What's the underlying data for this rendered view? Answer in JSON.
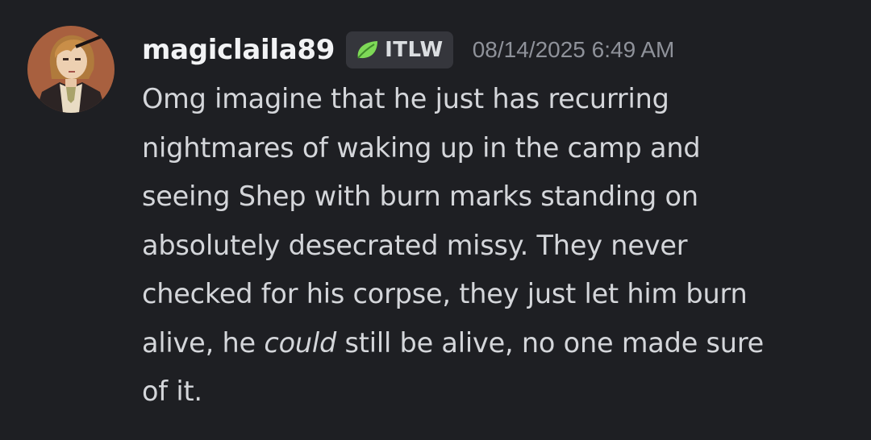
{
  "message": {
    "username": "magiclaila89",
    "tag": {
      "icon": "leaf-icon",
      "label": "ITLW",
      "color": "#7ed957"
    },
    "timestamp": "08/14/2025 6:49 AM",
    "lines": [
      "Omg imagine that he just has recurring",
      "nightmares of waking up in the camp and",
      "seeing Shep with burn marks standing on",
      "absolutely desecrated missy. They never",
      "checked for his corpse, they just let him burn"
    ],
    "line6": {
      "before": "alive, he ",
      "italic": "could",
      "after": " still be alive, no one made sure"
    },
    "last_line": "of it."
  },
  "colors": {
    "background": "#1e1f23",
    "username": "#f2f3f5",
    "text": "#d4d6da",
    "timestamp": "#8f929a",
    "tag_background": "#35363c"
  }
}
